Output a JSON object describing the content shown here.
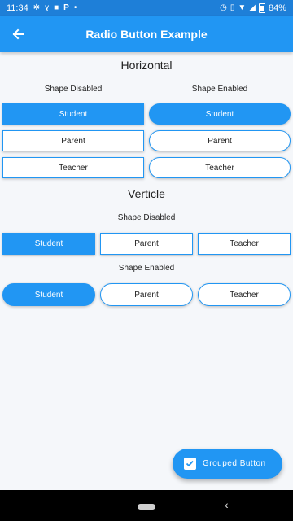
{
  "status_bar": {
    "time": "11:34",
    "battery": "84%",
    "left_icons": [
      "settings-icon",
      "signature-icon",
      "video-icon",
      "parking-icon",
      "dot-icon"
    ],
    "right_icons": [
      "alarm-icon",
      "vibrate-icon",
      "wifi-icon",
      "signal-icon",
      "battery-icon"
    ]
  },
  "app_bar": {
    "title": "Radio Button Example",
    "back_icon": "arrow-left-icon"
  },
  "horizontal": {
    "title": "Horizontal",
    "shape_disabled_label": "Shape Disabled",
    "shape_enabled_label": "Shape Enabled",
    "options": [
      "Student",
      "Parent",
      "Teacher"
    ],
    "selected": "Student"
  },
  "vertical": {
    "title": "Verticle",
    "shape_disabled_label": "Shape Disabled",
    "shape_enabled_label": "Shape Enabled",
    "options": [
      "Student",
      "Parent",
      "Teacher"
    ],
    "selected": "Student"
  },
  "fab": {
    "label": "Grouped Button",
    "checked": true
  },
  "colors": {
    "primary": "#2196f3",
    "status_bar": "#1e7fd8",
    "background": "#f5f7fa"
  }
}
